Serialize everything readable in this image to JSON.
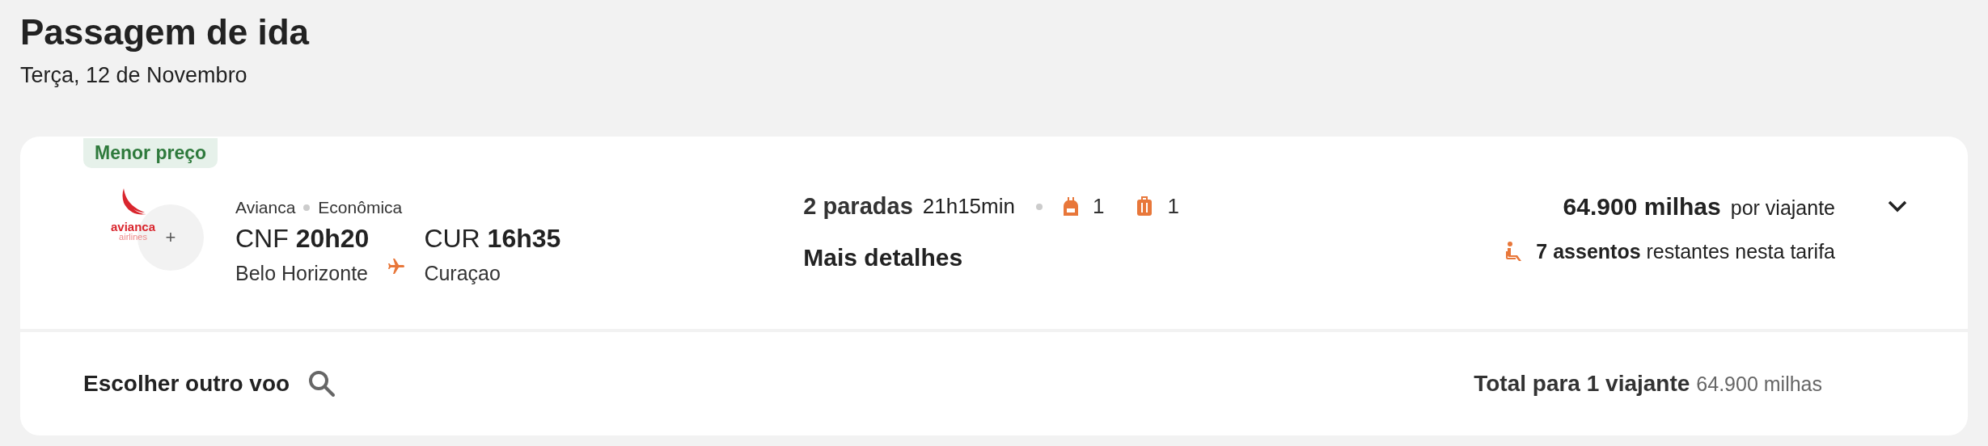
{
  "header": {
    "title": "Passagem de ida",
    "date": "Terça, 12 de Novembro"
  },
  "flight": {
    "badge": "Menor preço",
    "logo": {
      "name": "avianca",
      "sub": "airlines"
    },
    "more_airlines": "+",
    "airline": "Avianca",
    "cabin": "Econômica",
    "departure": {
      "code": "CNF",
      "time": "20h20",
      "city": "Belo Horizonte"
    },
    "arrival": {
      "code": "CUR",
      "time": "16h35",
      "city": "Curaçao"
    },
    "stops": "2 paradas",
    "duration": "21h15min",
    "baggage": [
      {
        "kind": "backpack",
        "count": "1"
      },
      {
        "kind": "suitcase",
        "count": "1"
      }
    ],
    "details_link": "Mais detalhes",
    "price": "64.900 milhas",
    "price_unit": "por viajante",
    "expanded": false,
    "seats_count": "7 assentos",
    "seats_text": "restantes nesta tarifa"
  },
  "footer": {
    "choose_other": "Escolher outro voo",
    "total_label": "Total para 1 viajante",
    "total_value": "64.900 milhas"
  }
}
